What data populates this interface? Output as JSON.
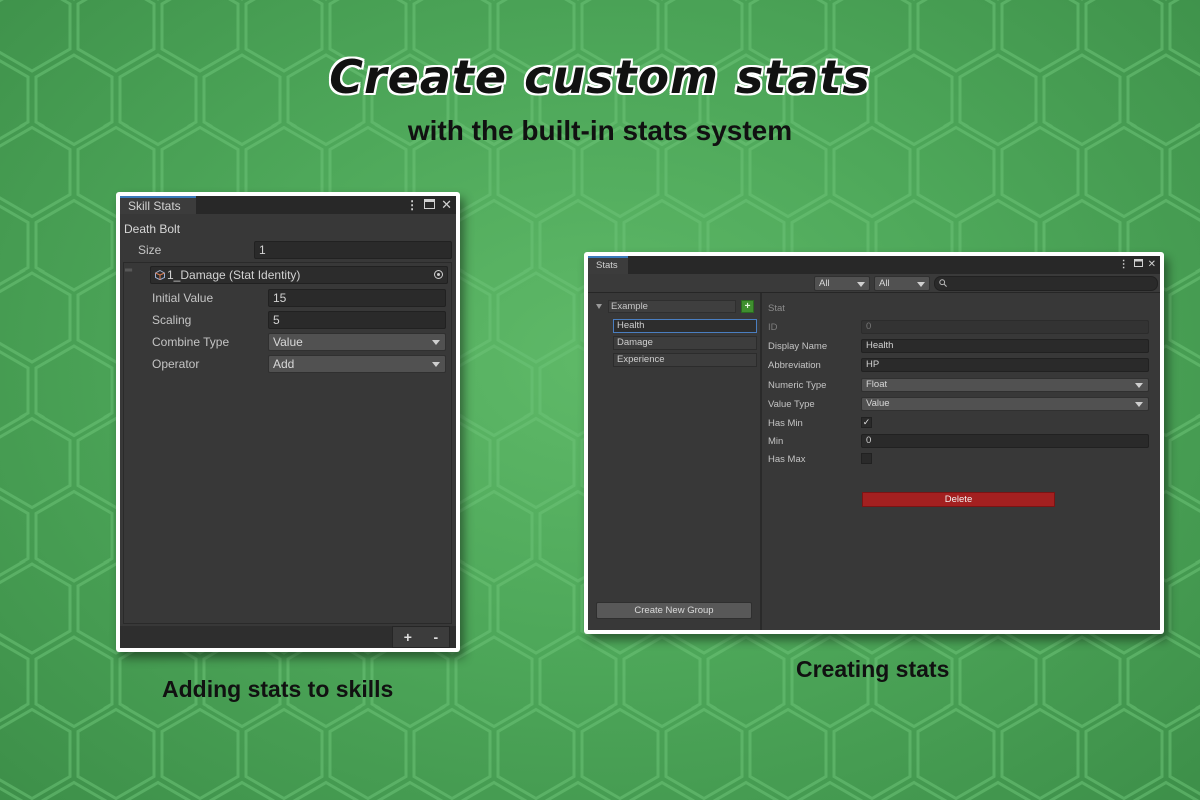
{
  "headline": "Create custom stats",
  "subheadline": "with the built-in stats system",
  "captions": {
    "left": "Adding stats to skills",
    "right": "Creating stats"
  },
  "skill_window": {
    "tab": "Skill Stats",
    "object_name": "Death Bolt",
    "size_label": "Size",
    "size_value": "1",
    "element_ref": "1_Damage (Stat Identity)",
    "fields": [
      {
        "label": "Initial Value",
        "value": "15",
        "kind": "input"
      },
      {
        "label": "Scaling",
        "value": "5",
        "kind": "input"
      },
      {
        "label": "Combine Type",
        "value": "Value",
        "kind": "dropdown"
      },
      {
        "label": "Operator",
        "value": "Add",
        "kind": "dropdown"
      }
    ],
    "add_glyph": "+",
    "remove_glyph": "-",
    "icons": [
      "kebab-menu-icon",
      "maximize-icon",
      "close-icon",
      "drag-handle-icon",
      "stat-identity-icon",
      "object-picker-icon"
    ]
  },
  "stats_window": {
    "tab": "Stats",
    "filter1": "All",
    "filter2": "All",
    "search_placeholder": "",
    "group_name": "Example",
    "add_glyph": "+",
    "stats_list": [
      "Health",
      "Damage",
      "Experience"
    ],
    "selected_stat": "Health",
    "create_group_label": "Create New Group",
    "section_title": "Stat",
    "form": {
      "id_label": "ID",
      "id_value": "0",
      "display_name_label": "Display Name",
      "display_name_value": "Health",
      "abbreviation_label": "Abbreviation",
      "abbreviation_value": "HP",
      "numeric_type_label": "Numeric Type",
      "numeric_type_value": "Float",
      "value_type_label": "Value Type",
      "value_type_value": "Value",
      "has_min_label": "Has Min",
      "has_min_checked": true,
      "check_glyph": "✓",
      "min_label": "Min",
      "min_value": "0",
      "has_max_label": "Has Max",
      "has_max_checked": false
    },
    "delete_label": "Delete",
    "colors": {
      "delete": "#a32020",
      "add": "#3f8f2f",
      "selection": "#4a7ec0"
    },
    "icons": [
      "kebab-menu-icon",
      "maximize-icon",
      "close-icon",
      "search-icon",
      "foldout-arrow-icon"
    ]
  }
}
